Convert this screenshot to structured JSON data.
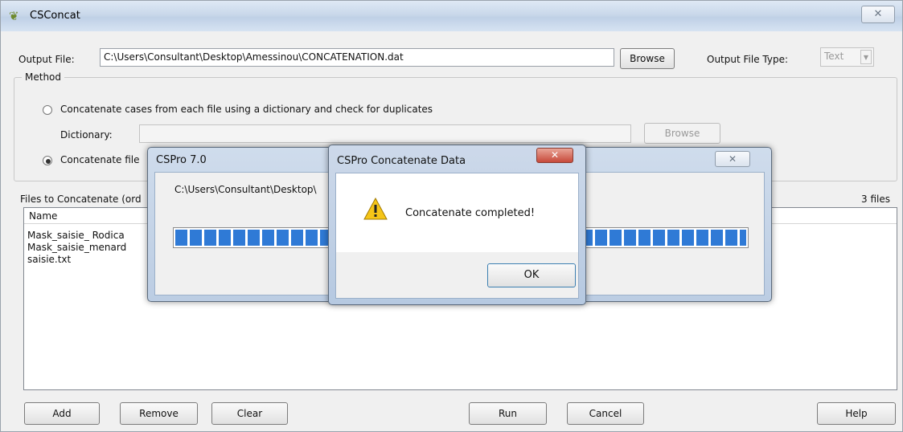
{
  "window": {
    "title": "CSConcat",
    "close_glyph": "✕"
  },
  "output": {
    "label": "Output File:",
    "value": "C:\\Users\\Consultant\\Desktop\\Amessinou\\CONCATENATION.dat",
    "browse_label": "Browse",
    "type_label": "Output File Type:",
    "type_value": "Text"
  },
  "method": {
    "legend": "Method",
    "option1_label": "Concatenate cases from each file using a dictionary and check for duplicates",
    "dictionary_label": "Dictionary:",
    "dictionary_value": "",
    "dictionary_browse_label": "Browse",
    "option2_label": "Concatenate file",
    "selected": 2
  },
  "files": {
    "label": "Files to Concatenate (ord",
    "count": "3 files",
    "column_name": "Name",
    "items": [
      "Mask_saisie_ Rodica",
      "Mask_saisie_menard",
      "saisie.txt"
    ]
  },
  "buttons": {
    "add": "Add",
    "remove": "Remove",
    "clear": "Clear",
    "run": "Run",
    "cancel": "Cancel",
    "help": "Help"
  },
  "progress_dialog": {
    "title": "CSPro 7.0",
    "path": "C:\\Users\\Consultant\\Desktop\\",
    "progress": 1.0
  },
  "message_dialog": {
    "title": "CSPro Concatenate Data",
    "message": "Concatenate completed!",
    "ok_label": "OK",
    "icon": "warning-icon"
  }
}
